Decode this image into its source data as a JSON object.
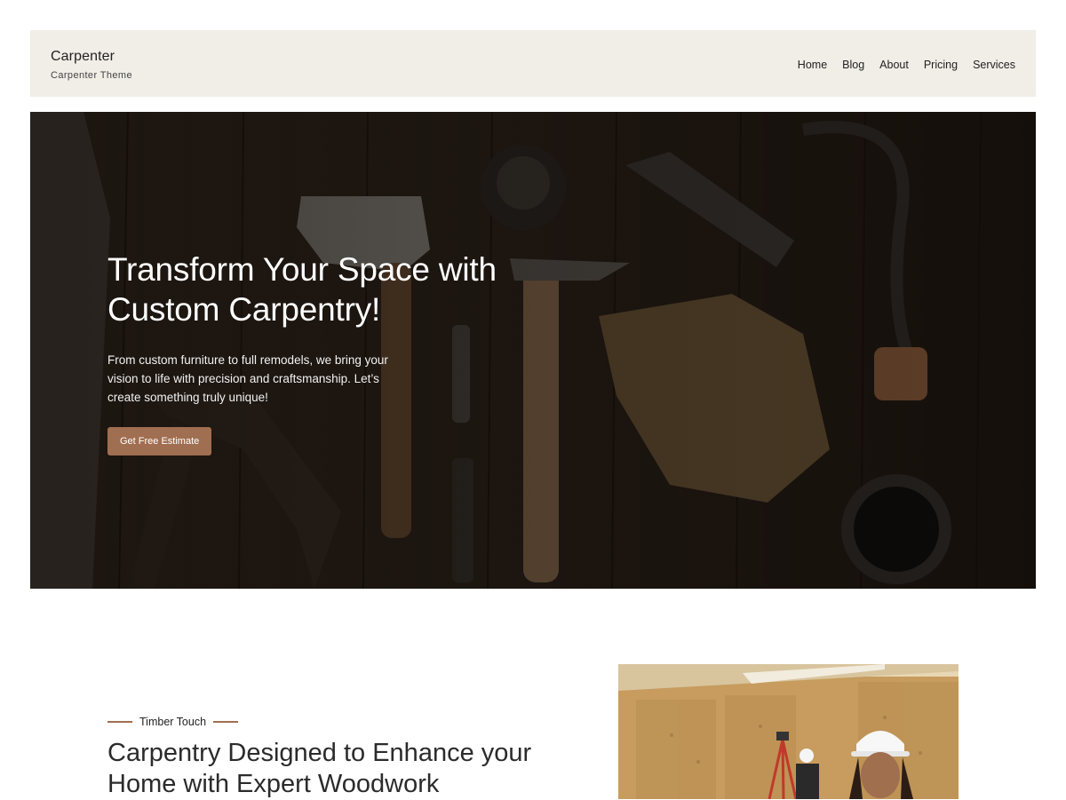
{
  "header": {
    "site_title": "Carpenter",
    "tagline": "Carpenter Theme",
    "nav": [
      {
        "label": "Home"
      },
      {
        "label": "Blog"
      },
      {
        "label": "About"
      },
      {
        "label": "Pricing"
      },
      {
        "label": "Services"
      }
    ]
  },
  "hero": {
    "heading_line1": "Transform Your Space with",
    "heading_line2": "Custom Carpentry!",
    "text": "From custom furniture to full remodels, we bring your vision to life with precision and craftsmanship. Let’s create something truly unique!",
    "button_label": "Get Free Estimate",
    "button_color": "#a06e50"
  },
  "section": {
    "eyebrow": "Timber Touch",
    "heading_line1": "Carpentry Designed to Enhance your",
    "heading_line2": "Home with Expert Woodwork"
  },
  "colors": {
    "header_bg": "#f1ede7",
    "accent": "#a06e50",
    "text": "#2b2b2b"
  }
}
